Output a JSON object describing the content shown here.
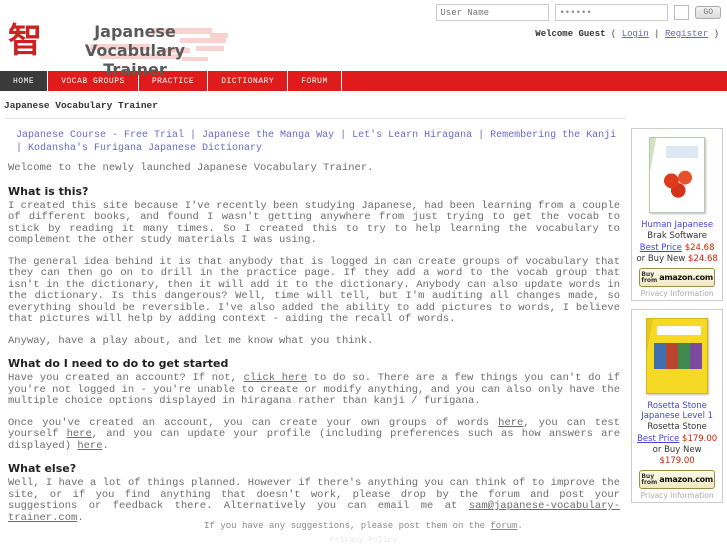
{
  "header": {
    "logo_kanji": "智",
    "site_title_line1": "Japanese Vocabulary",
    "site_title_line2": "Trainer",
    "login": {
      "username_placeholder": "User Name",
      "password_value": "••••••",
      "remember_checkbox": "",
      "go_label": "GO"
    },
    "welcome": {
      "text": "Welcome Guest",
      "open_paren": "(",
      "login_label": "Login",
      "divider": "|",
      "register_label": "Register",
      "close_paren": ")"
    }
  },
  "nav": {
    "items": [
      {
        "label": "HOME",
        "active": true
      },
      {
        "label": "VOCAB GROUPS",
        "active": false
      },
      {
        "label": "PRACTICE",
        "active": false
      },
      {
        "label": "DICTIONARY",
        "active": false
      },
      {
        "label": "FORUM",
        "active": false
      }
    ]
  },
  "page_subtitle": "Japanese Vocabulary Trainer",
  "sponsor_links": {
    "items": [
      "Japanese Course - Free Trial",
      "Japanese the Manga Way",
      "Let's Learn Hiragana",
      "Remembering the Kanji",
      "Kodansha's Furigana Japanese Dictionary"
    ],
    "separator": " | "
  },
  "main": {
    "welcome_line": "Welcome to the newly launched Japanese Vocabulary Trainer.",
    "sections": [
      {
        "heading": "What is this?",
        "paragraphs": [
          "I created this site because I've recently been studying Japanese, had been learning from a couple of different books, and found I wasn't getting anywhere from just trying to get the vocab to stick by reading it many times. So I created this to try to help learning the vocabulary to complement the other study materials I was using.",
          "The general idea behind it is that anybody that is logged in can create groups of vocabulary that they can then go on to drill in the practice page. If they add a word to the vocab group that isn't in the dictionary, then it will add it to the dictionary. Anybody can also update words in the dictionary. Is this dangerous? Well, time will tell, but I'm auditing all changes made, so everything should be reversible. I've also added the ability to add pictures to words, I believe that pictures will help by adding context - aiding the recall of words.",
          "Anyway, have a play about, and let me know what you think."
        ]
      }
    ],
    "getting_started": {
      "heading": "What do I need to do to get started",
      "para1_a": "Have you created an account? If not, ",
      "para1_link": "click here",
      "para1_b": " to do so. There are a few things you can't do if you're not logged in - you're unable to create or modify anything, and you can also only have the multiple choice options displayed in hiragana rather than kanji / furigana.",
      "para2_a": "Once you've created an account, you can create your own groups of words ",
      "para2_link1": "here",
      "para2_b": ", you can test yourself ",
      "para2_link2": "here",
      "para2_c": ", and you can update your profile (including preferences such as how answers are displayed) ",
      "para2_link3": "here",
      "para2_d": "."
    },
    "what_else": {
      "heading": "What else?",
      "text_a": "Well, I have a lot of things planned. However if there's anything you can think of to improve the site, or if you find anything that doesn't work, please drop by the forum and post your suggestions or feedback there. Alternatively you can email me at ",
      "email": "sam@japanese-vocabulary-trainer.com",
      "text_b": "."
    }
  },
  "sidebar": {
    "ads": [
      {
        "title": "Human Japanese",
        "sub_link": "",
        "brand": "Brak Software",
        "best_price_label": "Best Price",
        "best_price_value": "$24.68",
        "buy_new_label": "or Buy New",
        "buy_new_value": "$24.68",
        "button_buy": "Buy",
        "button_from": "from",
        "button_store": "amazon.com",
        "privacy": "Privacy Information"
      },
      {
        "title": "Rosetta Stone Japanese",
        "sub_link": "Level 1",
        "brand": "Rosetta Stone",
        "best_price_label": "Best Price",
        "best_price_value": "$179.00",
        "buy_new_label": "or Buy New",
        "buy_new_value": "$179.00",
        "button_buy": "Buy",
        "button_from": "from",
        "button_store": "amazon.com",
        "privacy": "Privacy Information"
      }
    ]
  },
  "footer": {
    "text_a": "If you have any suggestions, please post them on the ",
    "link": "forum",
    "text_b": ".",
    "bottom_line": "Privacy Policy"
  },
  "colors": {
    "nav_red": "#e01b1b",
    "active_tab": "#3a3a3a",
    "logo_red": "#cc2222",
    "link_blue": "#6a6aca",
    "price_red": "#cc2200"
  }
}
